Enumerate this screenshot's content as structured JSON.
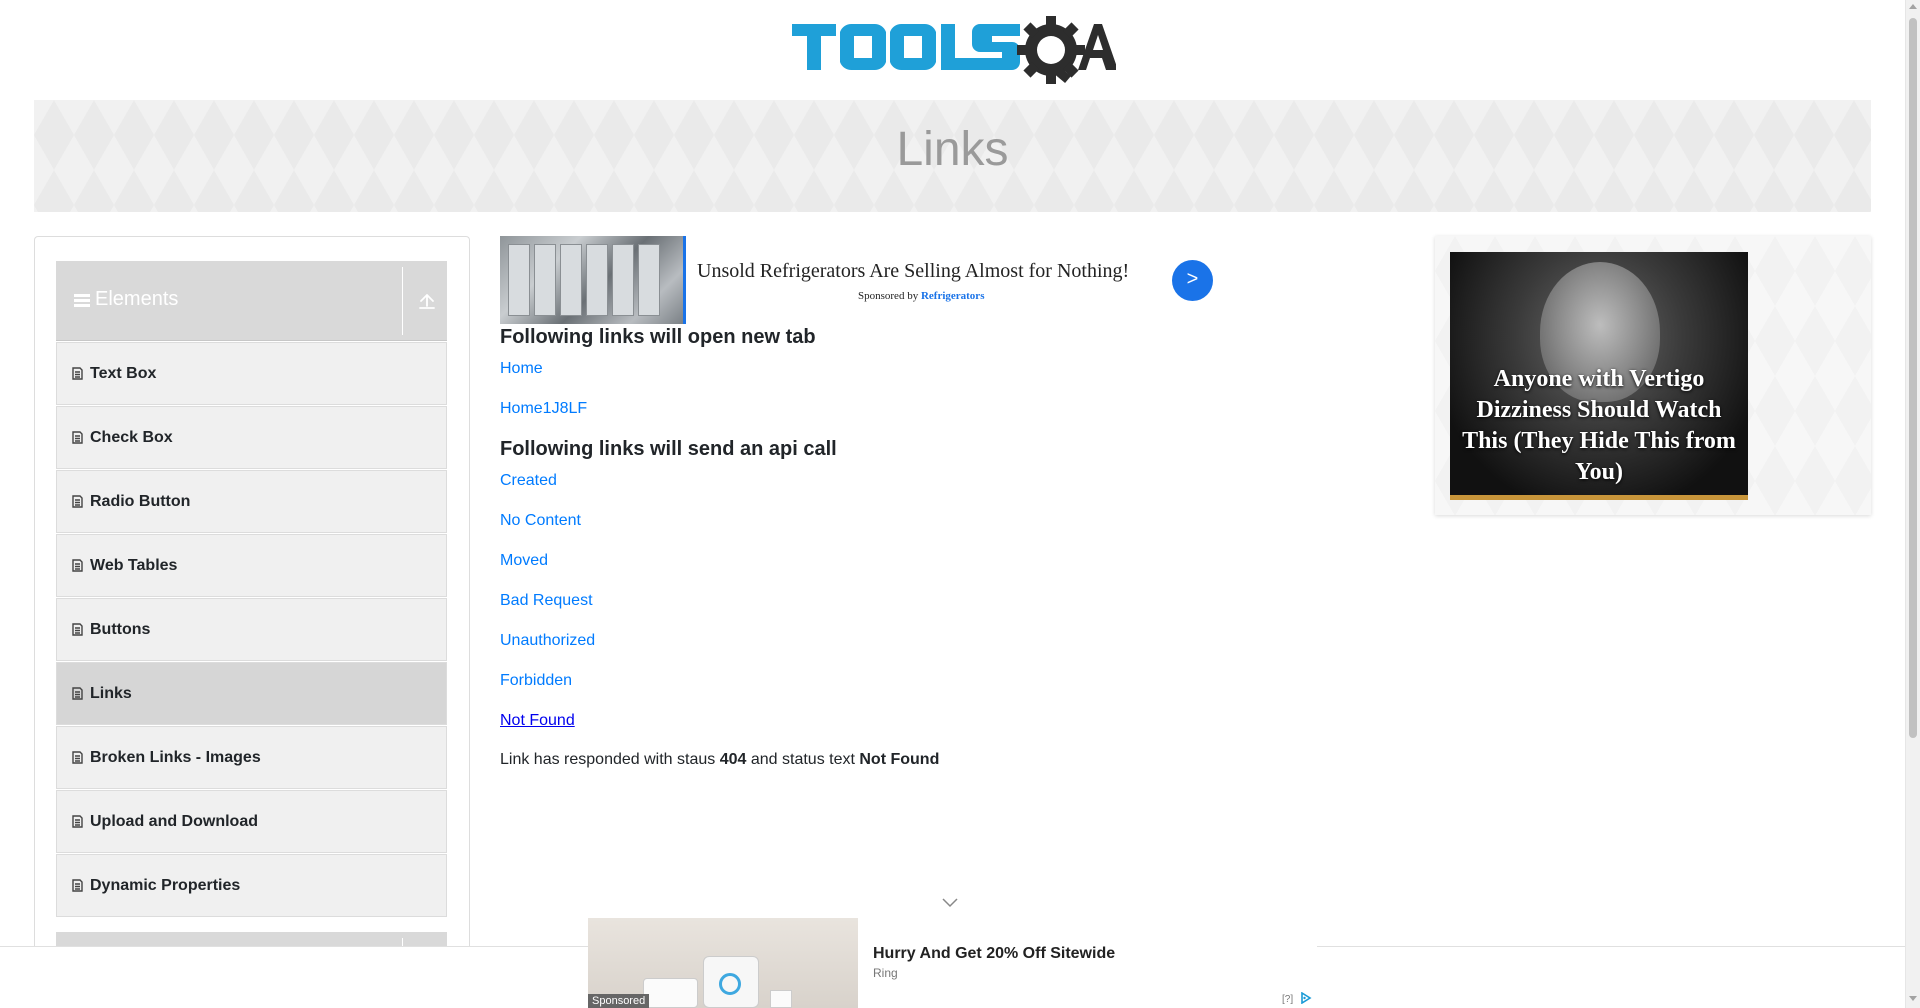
{
  "page": {
    "logo_text": "TOOLSQA",
    "title": "Links"
  },
  "sidebar": {
    "group_title": "Elements",
    "items": [
      {
        "label": "Text Box"
      },
      {
        "label": "Check Box"
      },
      {
        "label": "Radio Button"
      },
      {
        "label": "Web Tables"
      },
      {
        "label": "Buttons"
      },
      {
        "label": "Links",
        "active": true
      },
      {
        "label": "Broken Links - Images"
      },
      {
        "label": "Upload and Download"
      },
      {
        "label": "Dynamic Properties"
      }
    ]
  },
  "ad_top": {
    "headline": "Unsold Refrigerators Are Selling Almost for Nothing!",
    "sponsored_by": "Sponsored by",
    "sponsor": "Refrigerators",
    "arrow": ">"
  },
  "new_tab_section": {
    "title": "Following links will open new tab",
    "links": [
      "Home",
      "Home1J8LF"
    ]
  },
  "api_section": {
    "title": "Following links will send an api call",
    "links": [
      "Created",
      "No Content",
      "Moved",
      "Bad Request",
      "Unauthorized",
      "Forbidden",
      "Not Found"
    ]
  },
  "response": {
    "prefix": "Link has responded with staus",
    "status_code": "404",
    "middle": "and status text",
    "status_text": "Not Found"
  },
  "right_ad": {
    "text": "Anyone with Vertigo Dizziness Should Watch This (They Hide This from You)"
  },
  "bottom_ad": {
    "headline": "Hurry And Get 20% Off Sitewide",
    "brand": "Ring",
    "sponsored": "Sponsored",
    "info": "[?]"
  },
  "colors": {
    "link": "#007bff",
    "logo_blue": "#1fa0d8",
    "logo_dark": "#2d2d2d",
    "sidebar_header": "#d9d9d9",
    "ad_accent": "#1a73e8"
  },
  "icons": {
    "menu": "hamburger-icon",
    "collapse": "collapse-up-icon",
    "item": "document-icon",
    "scroll_hint": "chevron-down-icon",
    "adchoices": "adchoices-icon"
  }
}
